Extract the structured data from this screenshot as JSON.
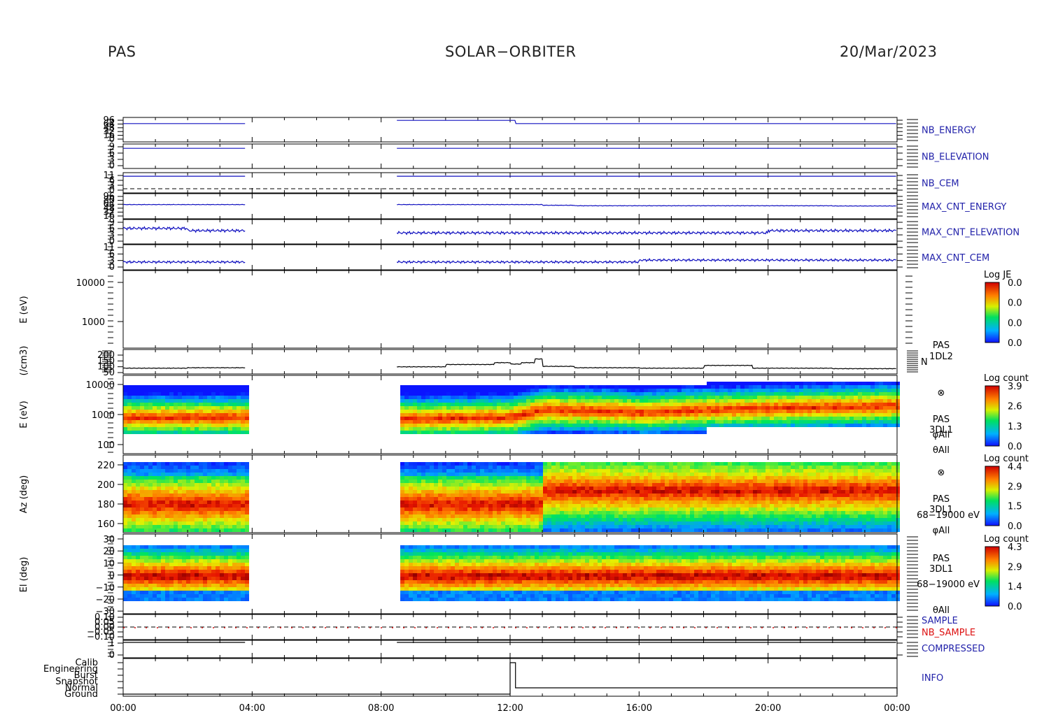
{
  "header": {
    "left": "PAS",
    "center": "SOLAR−ORBITER",
    "right": "20/Mar/2023"
  },
  "colors": {
    "axis": "#000000",
    "line_blue": "#1010c0",
    "label_blue": "#2222aa",
    "label_red": "#dd1111"
  },
  "chart_data": [
    {
      "type": "line",
      "name": "nb_energy",
      "right_label": "NB_ENERGY",
      "ytick_labels": [
        "96",
        "64",
        "48",
        "32",
        "16",
        "0"
      ],
      "x": [
        "00:00",
        "03:48",
        "08:28",
        "12:00",
        "12:10",
        "18:00",
        "24:00"
      ],
      "y": [
        80,
        80,
        96,
        96,
        80,
        80,
        80
      ]
    },
    {
      "type": "line",
      "name": "nb_elevation",
      "right_label": "NB_ELEVATION",
      "ytick_labels": [
        "9",
        "6",
        "3",
        "0"
      ],
      "x": [
        "00:00",
        "03:48",
        "08:28",
        "24:00"
      ],
      "y": [
        8,
        8,
        8,
        8
      ]
    },
    {
      "type": "line",
      "name": "nb_cem",
      "right_label": "NB_CEM",
      "ytick_labels": [
        "11",
        "6",
        "3",
        "0"
      ],
      "x": [
        "00:00",
        "03:48",
        "08:28",
        "24:00"
      ],
      "y": [
        10,
        10,
        10,
        10
      ]
    },
    {
      "type": "line",
      "name": "max_cnt_energy",
      "right_label": "MAX_CNT_ENERGY",
      "ytick_labels": [
        "96",
        "80",
        "64",
        "48",
        "32",
        "16"
      ],
      "x": [
        "00:00",
        "03:48",
        "08:28",
        "12:00",
        "13:00",
        "14:00",
        "18:00",
        "22:00",
        "24:00"
      ],
      "y": [
        62,
        62,
        62,
        62,
        59,
        57,
        57,
        56,
        53
      ]
    },
    {
      "type": "line",
      "name": "max_cnt_elevation",
      "right_label": "MAX_CNT_ELEVATION",
      "ytick_labels": [
        "9",
        "6",
        "3",
        "0"
      ],
      "x": [
        "00:00",
        "02:00",
        "03:48",
        "08:28",
        "12:00",
        "16:00",
        "20:00",
        "24:00"
      ],
      "y": [
        6,
        5,
        4,
        4,
        4,
        4,
        5,
        5
      ]
    },
    {
      "type": "line",
      "name": "max_cnt_cem",
      "right_label": "MAX_CNT_CEM",
      "ytick_labels": [
        "11",
        "6",
        "3",
        "0"
      ],
      "x": [
        "00:00",
        "03:48",
        "08:28",
        "13:30",
        "16:00",
        "20:00",
        "24:00"
      ],
      "y": [
        3,
        3,
        3,
        3,
        4,
        4,
        5
      ]
    },
    {
      "type": "heatmap",
      "name": "je_spectrogram",
      "ylabel": "E (eV)",
      "ytick_labels": [
        "10000",
        "1000"
      ],
      "colorbar": {
        "title": "Log JE",
        "ticks": [
          "0.0",
          "0.0",
          "0.0",
          "0.0"
        ]
      }
    },
    {
      "type": "line",
      "name": "density",
      "ylabel": "(/cm3)",
      "ytick_labels": [
        "200",
        "150",
        "100",
        "50"
      ],
      "right_label": [
        "PAS",
        "1DL2",
        "N"
      ],
      "x": [
        "00:00",
        "02:00",
        "03:48",
        "08:28",
        "10:00",
        "11:30",
        "12:00",
        "12:20",
        "12:45",
        "13:00",
        "14:00",
        "16:00",
        "18:00",
        "19:30",
        "22:00",
        "24:00"
      ],
      "y": [
        40,
        45,
        50,
        55,
        80,
        100,
        85,
        100,
        140,
        60,
        45,
        40,
        70,
        40,
        35,
        35
      ]
    },
    {
      "type": "heatmap",
      "name": "energy_spectrogram",
      "ylabel": "E (eV)",
      "ytick_labels": [
        "10000",
        "1000",
        "100"
      ],
      "right_label": [
        "PAS",
        "3DL1",
        "φAll",
        "θAll"
      ],
      "colorbar": {
        "title": "Log count",
        "ticks": [
          "3.9",
          "2.6",
          "1.3",
          "0.0"
        ]
      },
      "peak_energy_eV": {
        "x": [
          "00:00",
          "03:48",
          "08:28",
          "12:00",
          "13:00",
          "15:00",
          "16:00",
          "18:00",
          "20:00",
          "22:00",
          "24:00"
        ],
        "y": [
          900,
          900,
          800,
          900,
          1600,
          1500,
          1300,
          1600,
          1800,
          2000,
          2200
        ]
      }
    },
    {
      "type": "heatmap",
      "name": "azimuth_spectrogram",
      "ylabel": "Az (deg)",
      "ytick_labels": [
        "220",
        "200",
        "180",
        "160"
      ],
      "right_label": [
        "PAS",
        "3DL1",
        "68−19000 eV",
        "φAll"
      ],
      "colorbar": {
        "title": "Log count",
        "ticks": [
          "4.4",
          "2.9",
          "1.5",
          "0.0"
        ]
      }
    },
    {
      "type": "heatmap",
      "name": "elevation_spectrogram",
      "ylabel": "El (deg)",
      "ytick_labels": [
        "30",
        "20",
        "10",
        "0",
        "−10",
        "−20",
        "−30"
      ],
      "right_label": [
        "PAS",
        "3DL1",
        "68−19000 eV",
        "θAll"
      ],
      "colorbar": {
        "title": "Log count",
        "ticks": [
          "4.3",
          "2.9",
          "1.4",
          "0.0"
        ]
      }
    },
    {
      "type": "line",
      "name": "sample",
      "right_label": [
        "SAMPLE",
        "NB_SAMPLE"
      ],
      "ytick_labels": [
        "0.10",
        "0.05",
        "0.00",
        "−0.05",
        "−0.10"
      ],
      "y": [
        0,
        0
      ]
    },
    {
      "type": "line",
      "name": "compressed",
      "right_label": "COMPRESSED",
      "ytick_labels": [
        "1",
        "0"
      ],
      "x": [
        "00:00",
        "03:48",
        "08:28",
        "24:00"
      ],
      "y": [
        1,
        1,
        1,
        1
      ]
    },
    {
      "type": "line",
      "name": "info",
      "right_label": "INFO",
      "ytick_labels": [
        "Calib",
        "Engineering",
        "Burst",
        "Snapshot",
        "Normal",
        "Ground"
      ],
      "x": [
        "00:00",
        "03:48",
        "08:28",
        "12:00",
        "12:10",
        "24:00"
      ],
      "y": [
        "Ground",
        "Ground",
        "Ground",
        "Calib",
        "Normal",
        "Ground"
      ]
    }
  ],
  "x_axis": {
    "ticks": [
      "00:00",
      "04:00",
      "08:00",
      "12:00",
      "16:00",
      "20:00",
      "00:00"
    ]
  }
}
